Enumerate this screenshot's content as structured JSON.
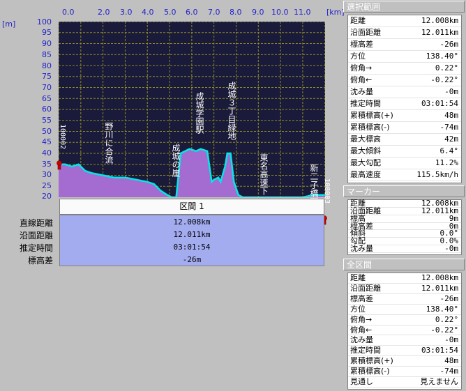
{
  "axis": {
    "x_unit": "[km]",
    "y_unit": "[m]",
    "x_ticks": [
      "0.0",
      "2.0",
      "3.0",
      "4.0",
      "5.0",
      "6.0",
      "7.0",
      "8.0",
      "9.0",
      "10.0",
      "11.0"
    ],
    "y_ticks": [
      "100",
      "95",
      "90",
      "85",
      "80",
      "75",
      "70",
      "65",
      "60",
      "55",
      "50",
      "45",
      "40",
      "35",
      "30",
      "25",
      "20"
    ]
  },
  "chart_data": {
    "type": "area",
    "xlabel": "[km]",
    "ylabel": "[m]",
    "xlim": [
      0,
      12.008
    ],
    "ylim": [
      20,
      100
    ],
    "grid": true,
    "x": [
      0.0,
      0.3,
      0.6,
      0.9,
      1.2,
      1.5,
      2.0,
      2.5,
      3.0,
      3.5,
      4.0,
      4.3,
      4.6,
      4.9,
      5.1,
      5.3,
      5.5,
      5.9,
      6.2,
      6.4,
      6.7,
      6.9,
      7.0,
      7.2,
      7.3,
      7.5,
      7.6,
      7.75,
      7.9,
      8.1,
      8.3,
      8.6,
      9.0,
      9.5,
      10.0,
      10.5,
      11.0,
      11.5,
      12.0
    ],
    "y": [
      35,
      35,
      34,
      35,
      32,
      31,
      30,
      29,
      29,
      28,
      27,
      26,
      23,
      21,
      20,
      20,
      40,
      42,
      41,
      42,
      41,
      27,
      28,
      29,
      27,
      34,
      40,
      40,
      27,
      21,
      20,
      20,
      20,
      20,
      20,
      20,
      20,
      21,
      21
    ]
  },
  "annotations": [
    {
      "text": "野川に合流"
    },
    {
      "text": "成城の崖"
    },
    {
      "text": "成城学園駅"
    },
    {
      "text": "成城３丁目緑地"
    },
    {
      "text": "東名高速下"
    },
    {
      "text": "新二子橋下"
    }
  ],
  "marker_labels": {
    "start": "100002",
    "end": "100003"
  },
  "section": {
    "header": "区間 1",
    "rows": [
      {
        "label": "直線距離",
        "value": "12.008km"
      },
      {
        "label": "沿面距離",
        "value": "12.011km"
      },
      {
        "label": "推定時間",
        "value": "03:01:54"
      },
      {
        "label": "標高差",
        "value": "-26m"
      }
    ]
  },
  "panels": [
    {
      "title": "選択範囲",
      "rows": [
        {
          "label": "距離",
          "value": "12.008km"
        },
        {
          "label": "沿面距離",
          "value": "12.011km"
        },
        {
          "label": "標高差",
          "value": "-26m"
        },
        {
          "label": "方位",
          "value": "138.40°"
        },
        {
          "label": "俯角→",
          "value": "0.22°"
        },
        {
          "label": "俯角←",
          "value": "-0.22°"
        },
        {
          "label": "沈み量",
          "value": "-0m"
        },
        {
          "label": "推定時間",
          "value": "03:01:54"
        },
        {
          "label": "累積標高(+)",
          "value": "48m"
        },
        {
          "label": "累積標高(-)",
          "value": "-74m"
        },
        {
          "label": "最大標高",
          "value": "42m"
        },
        {
          "label": "最大傾斜",
          "value": "6.4°"
        },
        {
          "label": "最大勾配",
          "value": "11.2%"
        },
        {
          "label": "最高速度",
          "value": "115.5km/h"
        }
      ]
    },
    {
      "title": "マーカー",
      "rows": [
        {
          "label": "距離",
          "value": "12.008km"
        },
        {
          "label": "沿面距離",
          "value": "12.011km"
        },
        {
          "label": "標高",
          "value": "9m"
        },
        {
          "label": "標高差",
          "value": "0m"
        },
        {
          "label": "傾斜",
          "value": "0.0°"
        },
        {
          "label": "勾配",
          "value": "0.0%"
        },
        {
          "label": "沈み量",
          "value": "-0m"
        }
      ]
    },
    {
      "title": "全区間",
      "rows": [
        {
          "label": "距離",
          "value": "12.008km"
        },
        {
          "label": "沿面距離",
          "value": "12.011km"
        },
        {
          "label": "標高差",
          "value": "-26m"
        },
        {
          "label": "方位",
          "value": "138.40°"
        },
        {
          "label": "俯角→",
          "value": "0.22°"
        },
        {
          "label": "俯角←",
          "value": "-0.22°"
        },
        {
          "label": "沈み量",
          "value": "-0m"
        },
        {
          "label": "推定時間",
          "value": "03:01:54"
        },
        {
          "label": "累積標高(+)",
          "value": "48m"
        },
        {
          "label": "累積標高(-)",
          "value": "-74m"
        },
        {
          "label": "見通し",
          "value": "見えません"
        }
      ]
    }
  ],
  "colors": {
    "plot_bg": "#1a1a3a",
    "grid": "#8c8c28",
    "fill": "#a46cd0",
    "line": "#00e8e8",
    "axis_text": "#2323c8",
    "stats_bg": "#a4acf0"
  }
}
